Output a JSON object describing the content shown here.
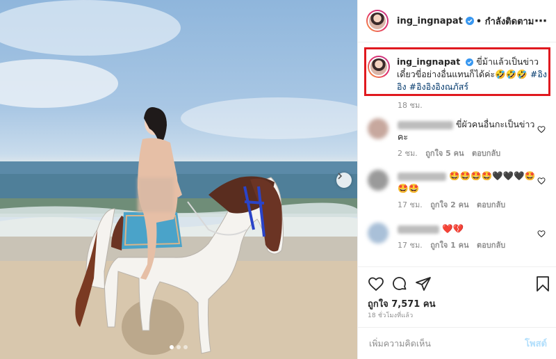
{
  "post": {
    "username": "ing_ingnapat",
    "follow_status": "• กำลังติดตาม",
    "more_icon": "more-options-icon"
  },
  "caption": {
    "username": "ing_ingnapat",
    "text": "ขี่ม้าแล้วเป็นข่าว เดี๋ยวขี่อย่างอื่นแทนก็ได้ค่ะ🤣🤣🤣",
    "hashtag1": "#อิงอิง",
    "hashtag2": "#อิงอิงอิงณภัสร์",
    "time": "18 ชม."
  },
  "comments": [
    {
      "text": "ขี่ผัวคนอื่นกะเป็นข่าวคะ",
      "time": "2 ชม.",
      "likes": "ถูกใจ 5 คน",
      "reply": "ตอบกลับ"
    },
    {
      "text": "🤩🤩🤩🤩🖤🖤🖤🤩🤩🤩",
      "time": "17 ชม.",
      "likes": "ถูกใจ 2 คน",
      "reply": "ตอบกลับ"
    },
    {
      "text": "❤️💔",
      "time": "17 ชม.",
      "likes": "ถูกใจ 1 คน",
      "reply": "ตอบกลับ"
    }
  ],
  "stats": {
    "likes": "ถูกใจ 7,571 คน",
    "posted": "18 ชั่วโมงที่แล้ว"
  },
  "composer": {
    "placeholder": "เพิ่มความคิดเห็น",
    "post_label": "โพสต์"
  },
  "carousel": {
    "total_slides": 3,
    "current_slide": 1
  },
  "colors": {
    "highlight_border": "#e0191f",
    "hashtag": "#00376b",
    "verified": "#3897f0"
  }
}
